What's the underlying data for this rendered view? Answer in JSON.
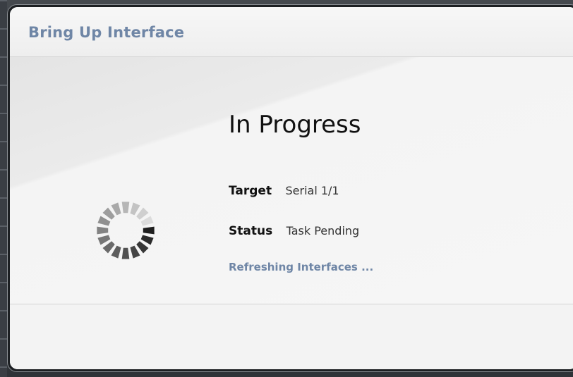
{
  "dialog": {
    "title": "Bring Up Interface",
    "heading": "In Progress",
    "target_label": "Target",
    "target_value": "Serial 1/1",
    "status_label": "Status",
    "status_value": "Task Pending",
    "progress_message": "Refreshing Interfaces ..."
  },
  "colors": {
    "title_color": "#6f86a6",
    "message_color": "#6f86a6"
  },
  "icons": {
    "spinner": "loading-spinner-icon"
  }
}
